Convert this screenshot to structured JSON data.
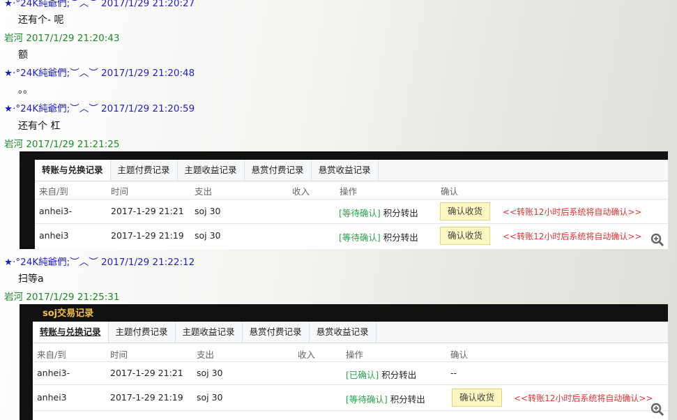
{
  "messages": [
    {
      "sender": "★·°24K純爺們;︶︿︶",
      "time": "2017/1/29 21:20:27",
      "color": "blue",
      "text": "还有个- 呢"
    },
    {
      "sender": "岩河",
      "time": "2017/1/29 21:20:43",
      "color": "green",
      "text": "额"
    },
    {
      "sender": "★·°24K純爺們;︶︿︶",
      "time": "2017/1/29 21:20:48",
      "color": "blue",
      "text": "。。"
    },
    {
      "sender": "★·°24K純爺們;︶︿︶",
      "time": "2017/1/29 21:20:59",
      "color": "blue",
      "text": "还有个 杠"
    },
    {
      "sender": "岩河",
      "time": "2017/1/29 21:21:25",
      "color": "green",
      "text": ""
    },
    {
      "sender": "★·°24K純爺們;︶︿︶",
      "time": "2017/1/29 21:22:12",
      "color": "blue",
      "text": "扫等a"
    },
    {
      "sender": "岩河",
      "time": "2017/1/29 21:25:31",
      "color": "green",
      "text": ""
    }
  ],
  "shot1": {
    "tabs": [
      "转账与兑换记录",
      "主题付费记录",
      "主题收益记录",
      "悬赏付费记录",
      "悬赏收益记录"
    ],
    "columns": [
      "来自/到",
      "时间",
      "支出",
      "收入",
      "操作",
      "确认"
    ],
    "rows": [
      {
        "from": "anhei3-",
        "time": "2017-1-29 21:21",
        "out": "soj 30",
        "in": "",
        "status": "[等待确认]",
        "op": "积分转出",
        "button": "确认收货",
        "note": "<<转账12小时后系统将自动确认>>"
      },
      {
        "from": "anhei3",
        "time": "2017-1-29 21:19",
        "out": "soj 30",
        "in": "",
        "status": "[等待确认]",
        "op": "积分转出",
        "button": "确认收货",
        "note": "<<转账12小时后系统将自动确认>>"
      }
    ]
  },
  "shot2": {
    "title": "soj交易记录",
    "tabs": [
      "转账与兑换记录",
      "主题付费记录",
      "主题收益记录",
      "悬赏付费记录",
      "悬赏收益记录"
    ],
    "columns": [
      "来自/到",
      "时间",
      "支出",
      "收入",
      "操作",
      "确认"
    ],
    "rows": [
      {
        "from": "anhei3-",
        "time": "2017-1-29 21:21",
        "out": "soj 30",
        "in": "",
        "status": "[已确认]",
        "op": "积分转出",
        "confirm": "--"
      },
      {
        "from": "anhei3",
        "time": "2017-1-29 21:19",
        "out": "soj 30",
        "in": "",
        "status": "[等待确认]",
        "op": "积分转出",
        "button": "确认收货",
        "note": "<<转账12小时后系统将自动确认>>"
      }
    ]
  },
  "colors": {
    "blue_sender": "#1e1ecc",
    "green_sender": "#1b8a2a",
    "pending": "#2aa14a",
    "note": "#e23232",
    "button_bg": "#fff7c2"
  }
}
